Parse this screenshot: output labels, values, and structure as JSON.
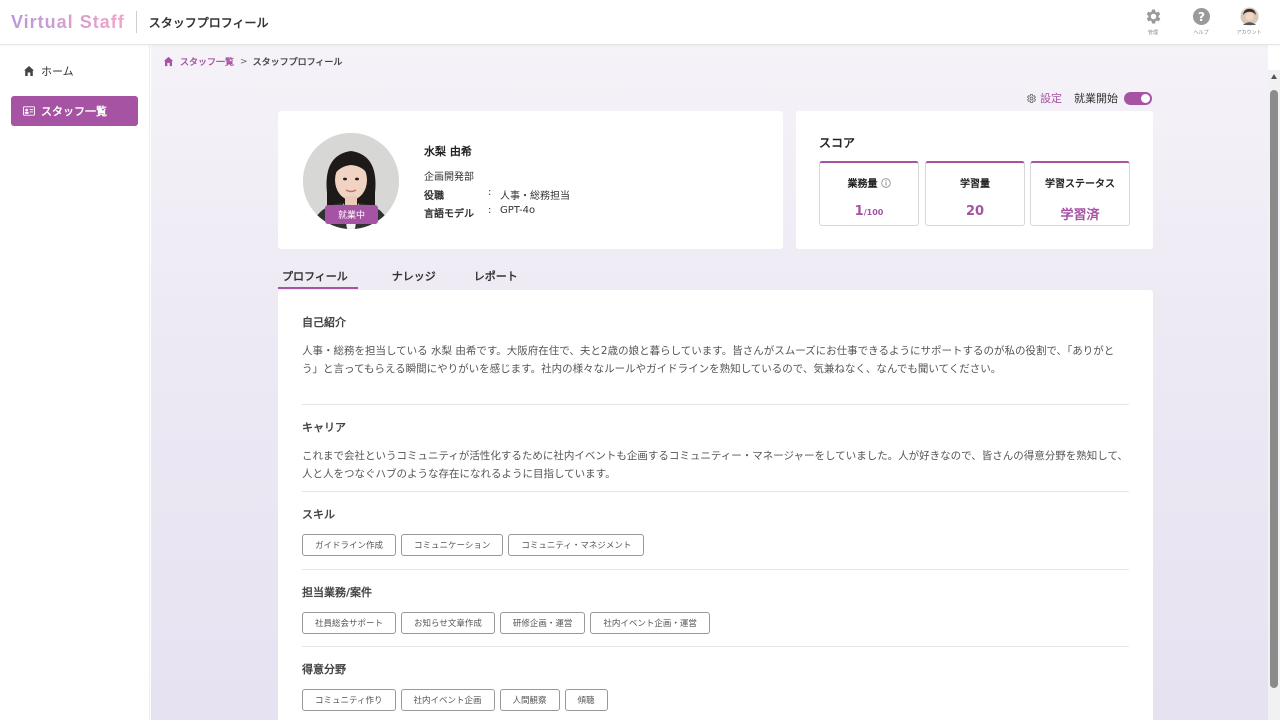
{
  "header": {
    "logo": "Virtual Staff",
    "title": "スタッフプロフィール",
    "buttons": [
      {
        "label": "管理",
        "icon": "gear-icon"
      },
      {
        "label": "ヘルプ",
        "icon": "help-icon"
      },
      {
        "label": "アカウント",
        "icon": "account-avatar-icon"
      }
    ]
  },
  "sidebar": {
    "items": [
      {
        "label": "ホーム",
        "icon": "home-icon"
      },
      {
        "label": "スタッフ一覧",
        "icon": "id-card-icon",
        "active": true
      }
    ]
  },
  "breadcrumb": {
    "link": "スタッフ一覧",
    "separator": ">",
    "current": "スタッフプロフィール"
  },
  "controls": {
    "settings_label": "設定",
    "work_label": "就業開始",
    "work_on": true
  },
  "profile": {
    "status": "就業中",
    "name": "水梨 由希",
    "department": "企画開発部",
    "role_key": "役職",
    "role_value": "人事・総務担当",
    "model_key": "言語モデル",
    "model_value": "GPT-4o",
    "colon": ":"
  },
  "score": {
    "title": "スコア",
    "workload_label": "業務量",
    "workload_value": "1",
    "workload_max": "/100",
    "learning_label": "学習量",
    "learning_value": "20",
    "status_label": "学習ステータス",
    "status_value": "学習済"
  },
  "tabs": [
    "プロフィール",
    "ナレッジ",
    "レポート"
  ],
  "sections": {
    "intro_title": "自己紹介",
    "intro_text": "人事・総務を担当している 水梨 由希です。大阪府在住で、夫と2歳の娘と暮らしています。皆さんがスムーズにお仕事できるようにサポートするのが私の役割で、「ありがとう」と言ってもらえる瞬間にやりがいを感じます。社内の様々なルールやガイドラインを熟知しているので、気兼ねなく、なんでも聞いてください。",
    "career_title": "キャリア",
    "career_text": "これまで会社というコミュニティが活性化するために社内イベントも企画するコミュニティー・マネージャーをしていました。人が好きなので、皆さんの得意分野を熟知して、人と人をつなぐハブのような存在になれるように目指しています。",
    "skills_title": "スキル",
    "skills": [
      "ガイドライン作成",
      "コミュニケーション",
      "コミュニティ・マネジメント"
    ],
    "duties_title": "担当業務/案件",
    "duties": [
      "社員総会サポート",
      "お知らせ文章作成",
      "研修企画・運営",
      "社内イベント企画・運営"
    ],
    "strengths_title": "得意分野",
    "strengths": [
      "コミュニティ作り",
      "社内イベント企画",
      "人間観察",
      "傾聴"
    ]
  },
  "colors": {
    "accent": "#a653a3",
    "tag_border": "#999999"
  }
}
